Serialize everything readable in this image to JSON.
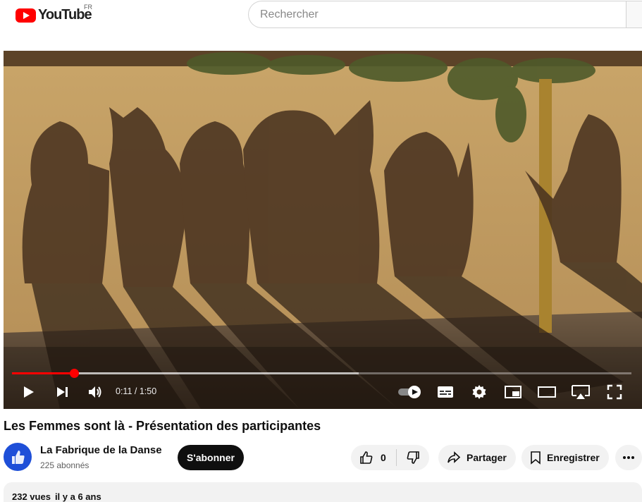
{
  "header": {
    "logo_text": "YouTube",
    "region": "FR",
    "search_placeholder": "Rechercher",
    "brand_color": "#ff0000"
  },
  "player": {
    "current_time": "0:11",
    "duration": "1:50",
    "time_display": "0:11 / 1:50",
    "progress_fraction": 0.1,
    "buffered_fraction": 0.56,
    "icons": [
      "play-icon",
      "next-icon",
      "volume-icon",
      "autoplay-toggle-icon",
      "subtitles-icon",
      "settings-gear-icon",
      "miniplayer-icon",
      "theater-mode-icon",
      "airplay-icon",
      "fullscreen-icon"
    ]
  },
  "video": {
    "title": "Les Femmes sont là - Présentation des participantes"
  },
  "channel": {
    "name": "La Fabrique de la Danse",
    "subscribers": "225 abonnés",
    "subscribe_label": "S'abonner",
    "avatar_color": "#1e4fd8"
  },
  "actions": {
    "like_count": "0",
    "share_label": "Partager",
    "save_label": "Enregistrer"
  },
  "description": {
    "views": "232 vues",
    "age": "il y a 6 ans"
  }
}
